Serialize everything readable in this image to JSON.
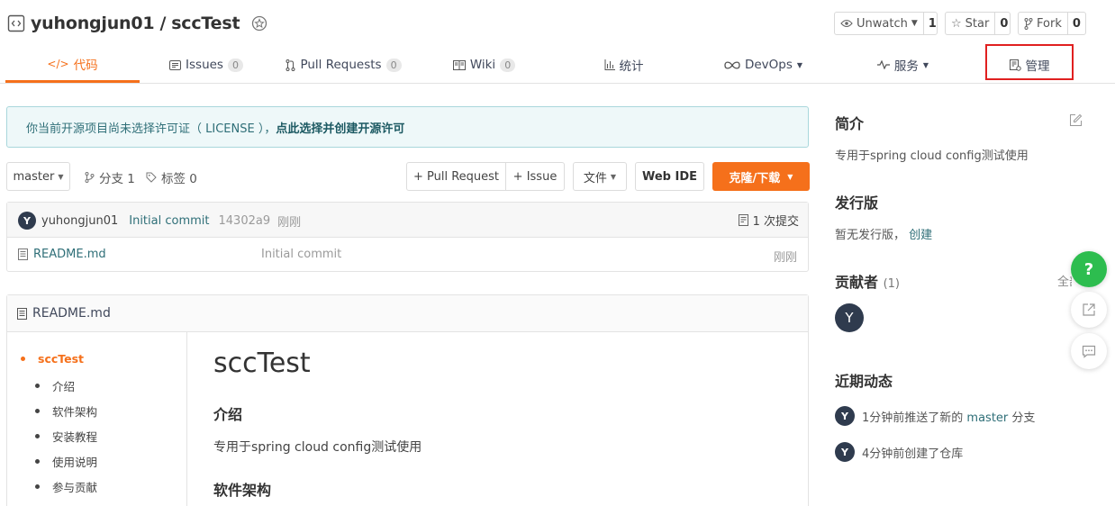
{
  "repo": {
    "owner": "yuhongjun01",
    "separator": "/",
    "name": "sccTest"
  },
  "header_buttons": {
    "watch": {
      "label": "Unwatch",
      "count": "1"
    },
    "star": {
      "label": "Star",
      "count": "0"
    },
    "fork": {
      "label": "Fork",
      "count": "0"
    }
  },
  "tabs": [
    {
      "label": "代码",
      "badge": null
    },
    {
      "label": "Issues",
      "badge": "0"
    },
    {
      "label": "Pull Requests",
      "badge": "0"
    },
    {
      "label": "Wiki",
      "badge": "0"
    },
    {
      "label": "统计",
      "badge": null
    },
    {
      "label": "DevOps",
      "badge": null
    },
    {
      "label": "服务",
      "badge": null
    },
    {
      "label": "管理",
      "badge": null
    }
  ],
  "notice": {
    "text": "你当前开源项目尚未选择许可证（ LICENSE ），",
    "link": "点此选择并创建开源许可"
  },
  "toolbar": {
    "branch": "master",
    "branches": "分支 1",
    "tags": "标签 0",
    "pull_request": "+ Pull Request",
    "issue": "+ Issue",
    "file": "文件",
    "web_ide": "Web IDE",
    "clone": "克隆/下载"
  },
  "commit": {
    "avatar": "Y",
    "author": "yuhongjun01",
    "message": "Initial commit",
    "hash": "14302a9",
    "time": "刚刚",
    "count": "1 次提交"
  },
  "files": [
    {
      "name": "README.md",
      "message": "Initial commit",
      "time": "刚刚"
    }
  ],
  "readme": {
    "title": "README.md",
    "toc": [
      "sccTest",
      "介绍",
      "软件架构",
      "安装教程",
      "使用说明",
      "参与贡献"
    ],
    "h1": "sccTest",
    "h2_intro": "介绍",
    "intro_text": "专用于spring cloud config测试使用",
    "h2_arch": "软件架构"
  },
  "sidebar": {
    "intro_title": "简介",
    "intro_text": "专用于spring cloud config测试使用",
    "release_title": "发行版",
    "release_text": "暂无发行版，",
    "release_link": "创建",
    "contrib_title": "贡献者",
    "contrib_count": "(1)",
    "contrib_all": "全部",
    "contrib_avatar": "Y",
    "activity_title": "近期动态",
    "activity": [
      {
        "avatar": "Y",
        "pre": "1分钟前推送了新的",
        "link": "master",
        "post": "分支"
      },
      {
        "avatar": "Y",
        "pre": "4分钟前创建了仓库",
        "link": "",
        "post": ""
      }
    ]
  },
  "floating": {
    "help": "?"
  },
  "colors": {
    "accent": "#f5701b",
    "link": "#2f6f78",
    "avatar": "#2f3b4e",
    "help": "#2dbd4f",
    "highlight_box": "#e02020"
  }
}
